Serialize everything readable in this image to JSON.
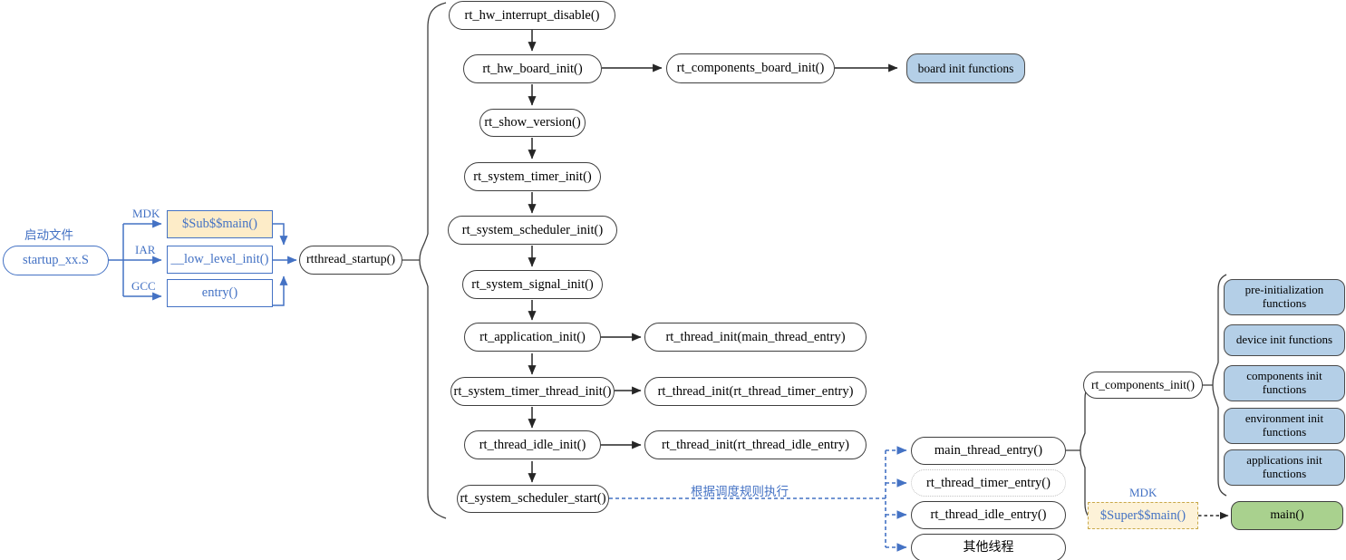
{
  "diagram": {
    "title": "RT-Thread startup flow",
    "colors": {
      "accent_blue": "#4472c4",
      "node_blue_fill": "#b4cfe7",
      "node_green_fill": "#a9d18e",
      "node_tan_fill": "#fdecc8",
      "node_outline": "#3f3f3f",
      "dashed_flow": "#4472c4"
    }
  },
  "startup": {
    "file_label": "启动文件",
    "file_node": "startup_xx.S",
    "branches": [
      {
        "toolchain": "MDK",
        "node": "$Sub$$main()"
      },
      {
        "toolchain": "IAR",
        "node": "__low_level_init()"
      },
      {
        "toolchain": "GCC",
        "node": "entry()"
      }
    ],
    "entry_node": "rtthread_startup()"
  },
  "main_chain": [
    "rt_hw_interrupt_disable()",
    "rt_hw_board_init()",
    "rt_show_version()",
    "rt_system_timer_init()",
    "rt_system_scheduler_init()",
    "rt_system_signal_init()",
    "rt_application_init()",
    "rt_system_timer_thread_init()",
    "rt_thread_idle_init()",
    "rt_system_scheduler_start()"
  ],
  "side_nodes": {
    "components_board_init": "rt_components_board_init()",
    "board_init_functions": "board init functions",
    "thread_init_main": "rt_thread_init(main_thread_entry)",
    "thread_init_timer": "rt_thread_init(rt_thread_timer_entry)",
    "thread_init_idle": "rt_thread_init(rt_thread_idle_entry)"
  },
  "scheduler": {
    "edge_label": "根据调度规则执行",
    "threads": [
      "main_thread_entry()",
      "rt_thread_timer_entry()",
      "rt_thread_idle_entry()",
      "其他线程"
    ]
  },
  "components": {
    "init_node": "rt_components_init()",
    "init_functions": [
      "pre-initialization functions",
      "device init functions",
      "components init functions",
      "environment init functions",
      "applications init functions"
    ]
  },
  "app_entry": {
    "toolchain_label": "MDK",
    "super_main": "$Super$$main()",
    "main": "main()"
  }
}
